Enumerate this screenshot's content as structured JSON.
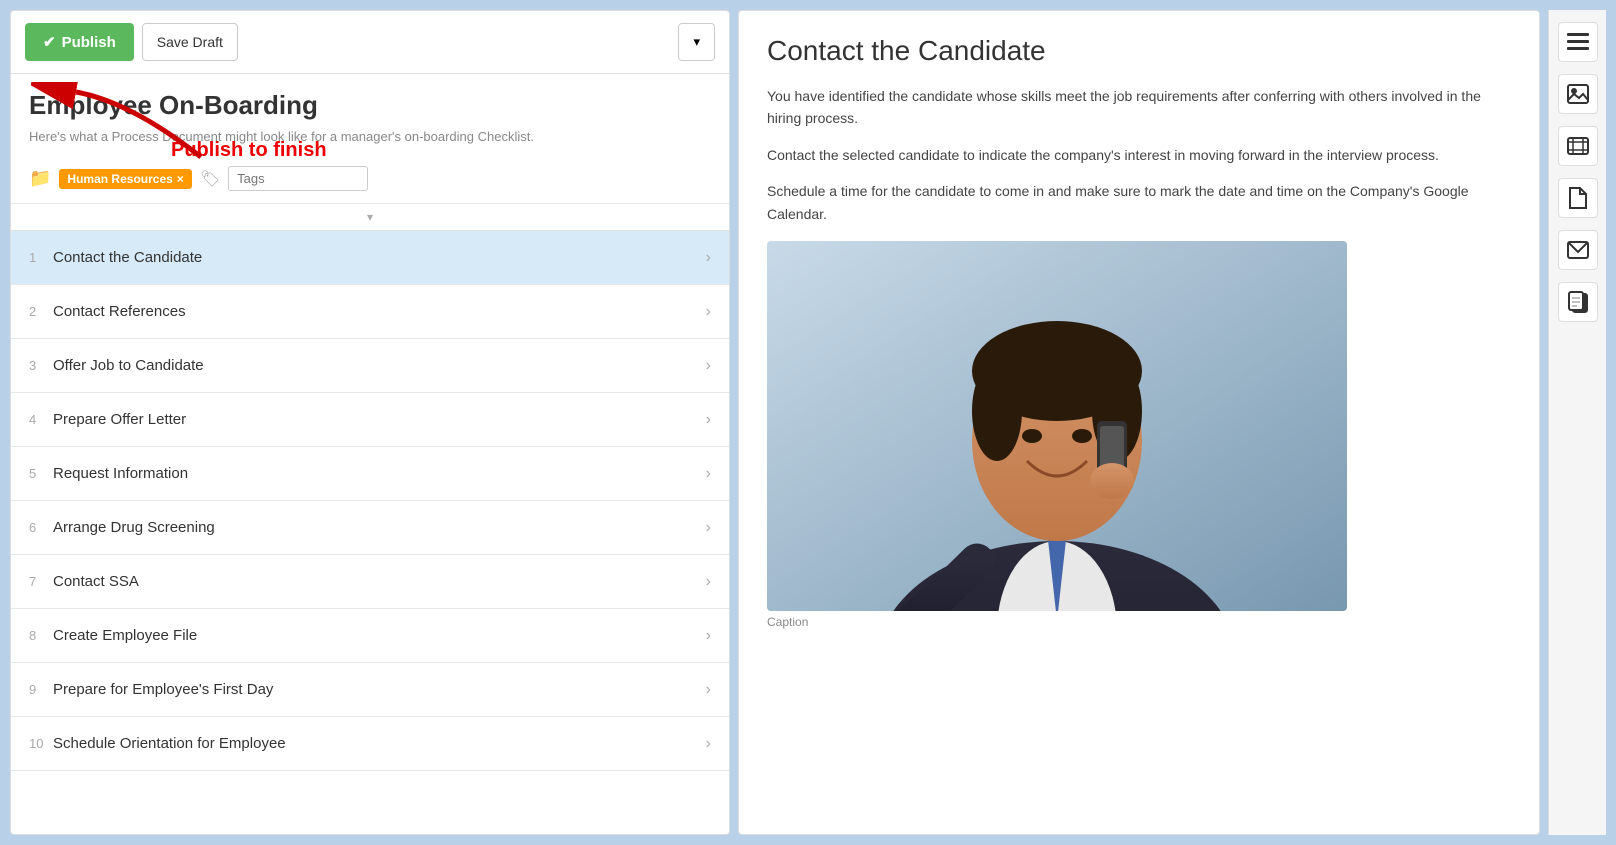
{
  "toolbar": {
    "publish_label": "Publish",
    "save_draft_label": "Save Draft",
    "dropdown_icon": "▾"
  },
  "document": {
    "title": "Employee On-Boarding",
    "subtitle": "Here's what a Process Document might look like for a manager's on-boarding Checklist.",
    "annotation_text": "Publish to finish",
    "tag": "Human Resources",
    "tags_placeholder": "Tags"
  },
  "checklist": {
    "items": [
      {
        "number": "1",
        "label": "Contact the Candidate",
        "active": true
      },
      {
        "number": "2",
        "label": "Contact References",
        "active": false
      },
      {
        "number": "3",
        "label": "Offer Job to Candidate",
        "active": false
      },
      {
        "number": "4",
        "label": "Prepare Offer Letter",
        "active": false
      },
      {
        "number": "5",
        "label": "Request Information",
        "active": false
      },
      {
        "number": "6",
        "label": "Arrange Drug Screening",
        "active": false
      },
      {
        "number": "7",
        "label": "Contact SSA",
        "active": false
      },
      {
        "number": "8",
        "label": "Create Employee File",
        "active": false
      },
      {
        "number": "9",
        "label": "Prepare for Employee's First Day",
        "active": false
      },
      {
        "number": "10",
        "label": "Schedule Orientation for Employee",
        "active": false
      }
    ]
  },
  "content": {
    "title": "Contact the Candidate",
    "paragraphs": [
      "You have identified the candidate whose skills meet the job requirements after conferring with others involved in the hiring process.",
      "Contact the selected candidate to indicate the company's interest in moving forward in the interview process.",
      "Schedule a time for the candidate to come in and make sure to mark the date and time on the Company's Google Calendar."
    ],
    "image_caption": "Caption"
  },
  "right_sidebar": {
    "icons": [
      {
        "name": "menu-icon",
        "symbol": "≡"
      },
      {
        "name": "image-icon",
        "symbol": "🖼"
      },
      {
        "name": "video-icon",
        "symbol": "🎬"
      },
      {
        "name": "file-icon",
        "symbol": "📄"
      },
      {
        "name": "email-icon",
        "symbol": "✉"
      },
      {
        "name": "copy-icon",
        "symbol": "📋"
      }
    ]
  },
  "colors": {
    "publish_green": "#5cb85c",
    "tag_orange": "#f90",
    "active_blue": "#d6eaf8",
    "annotation_red": "#cc0000"
  }
}
